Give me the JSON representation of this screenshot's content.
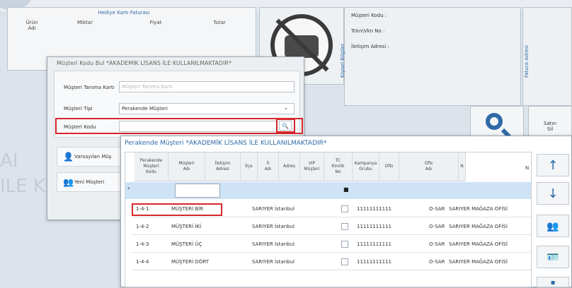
{
  "hediye": {
    "title": "Hediye Kartı Faturası",
    "col_urun": "Ürün\nAdı",
    "col_miktar": "Miktar",
    "col_fiyat": "Fiyat",
    "col_tutar": "Tutar"
  },
  "info": {
    "kisisel": "Kişisel Bilgiler",
    "musteri_kodu": "Müşteri Kodu  :",
    "tckn": "Tckn\\Vkn No  :",
    "iletisim": "İletişim Adresi  :",
    "fatura": "Fatura Adresi"
  },
  "satis": {
    "label": "Satırı\nSil"
  },
  "bg_text": "AI\nILE K",
  "dialog1": {
    "title": "Müşteri Kodu Bul *AKADEMİK LİSANS İLE KULLANILMAKTADIR*",
    "kart_label": "Müşteri Tanıma Kartı",
    "kart_placeholder": "Müşteri Tanıma Kartı",
    "tip_label": "Müşteri Tipi",
    "tip_value": "Perakende Müşteri",
    "kod_label": "Müşteri Kodu",
    "btn_varsayilan": "Varsayılan Müş",
    "btn_yeni": "Yeni Müşteri"
  },
  "dialog2": {
    "title": "Perakende Müşteri *AKADEMİK LİSANS İLE KULLANILMAKTADIR*",
    "columns": [
      "Perakende\nMüşteri\nKodu",
      "Müşteri\nAdı",
      "İletişim\nAdresi",
      "İlçe",
      "İl\nAdı",
      "Adres",
      "VIP\nMüşteri",
      "TC\nKimlik\nNo",
      "Kampanya\nGrubu",
      "Ofis",
      "Ofis\nAdı",
      "N"
    ],
    "new_row_marker": "*",
    "new_row_dot": "■",
    "rows": [
      {
        "kod": "1-4-1",
        "ad": "MÜŞTERİ BİR",
        "ilce": "SARIYER",
        "il": "İstanbul",
        "tc": "11111111111",
        "ofis": "O-SAR",
        "ofis_adi": "SARIYER MAĞAZA OFİSİ"
      },
      {
        "kod": "1-4-2",
        "ad": "MÜŞTERİ İKİ",
        "ilce": "SARIYER",
        "il": "İstanbul",
        "tc": "11111111111",
        "ofis": "O-SAR",
        "ofis_adi": "SARIYER MAĞAZA OFİSİ"
      },
      {
        "kod": "1-4-3",
        "ad": "MÜŞTERİ ÜÇ",
        "ilce": "SARIYER",
        "il": "İstanbul",
        "tc": "11111111111",
        "ofis": "O-SAR",
        "ofis_adi": "SARIYER MAĞAZA OFİSİ"
      },
      {
        "kod": "1-4-4",
        "ad": "MÜŞTERİ DÖRT",
        "ilce": "SARIYER",
        "il": "İstanbul",
        "tc": "11111111111",
        "ofis": "O-SAR",
        "ofis_adi": "SARIYER MAĞAZA OFİSİ"
      }
    ]
  },
  "nav": {
    "up": "arrow-up-icon",
    "down": "arrow-down-icon",
    "users": "users-icon",
    "card": "id-card-icon"
  },
  "colors": {
    "accent": "#2e6aa6",
    "highlight": "#d7272b",
    "selected_row": "#cfe3f7"
  }
}
